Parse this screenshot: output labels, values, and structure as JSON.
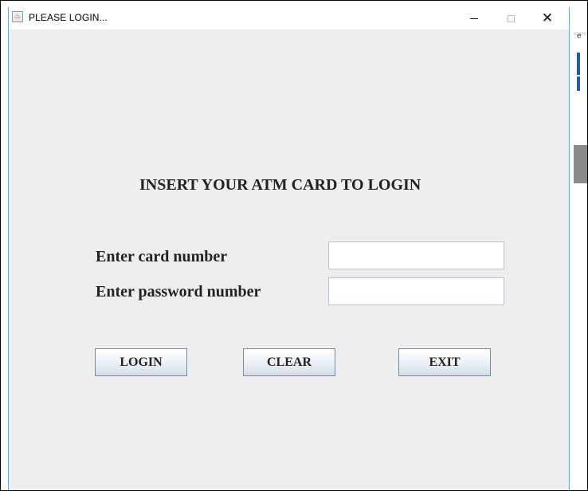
{
  "window": {
    "title": "PLEASE LOGIN..."
  },
  "form": {
    "heading": "INSERT YOUR ATM CARD TO LOGIN",
    "card_label": "Enter card number",
    "card_value": "",
    "password_label": "Enter password number",
    "password_value": ""
  },
  "buttons": {
    "login": "LOGIN",
    "clear": "CLEAR",
    "exit": "EXIT"
  },
  "background_window": {
    "glyph": "e"
  }
}
